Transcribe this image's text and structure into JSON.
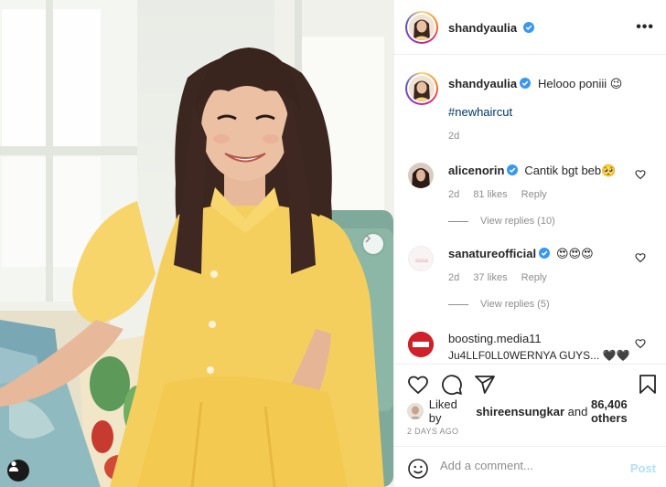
{
  "author": {
    "username": "shandyaulia",
    "verified": true
  },
  "header": {
    "more_label": "•••"
  },
  "caption": {
    "username": "shandyaulia",
    "text": "Helooo poniii 😉",
    "hashtag": "#newhaircut",
    "age": "2d"
  },
  "comments": [
    {
      "username": "alicenorin",
      "verified": true,
      "text": "Cantik bgt beb🥺",
      "age": "2d",
      "likes": "81 likes",
      "reply_label": "Reply",
      "view_replies": "View replies (10)"
    },
    {
      "username": "sanatureofficial",
      "verified": true,
      "text": "😍😍😍",
      "age": "2d",
      "likes": "37 likes",
      "reply_label": "Reply",
      "view_replies": "View replies (5)"
    },
    {
      "username": "boosting.media11",
      "verified": false,
      "text": "Ju4LLF0LL0WERNYA GUYS... 🖤🖤"
    }
  ],
  "likes": {
    "prefix": "Liked by",
    "user": "shireensungkar",
    "and": "and",
    "others": "86,406 others"
  },
  "posted_ago": "2 DAYS AGO",
  "add_comment": {
    "placeholder": "Add a comment...",
    "post_label": "Post"
  },
  "colors": {
    "link": "#00376b",
    "muted": "#8e8e8e",
    "verified": "#3897f0",
    "post_disabled": "#b2dffc",
    "dress": "#f5cf5e"
  },
  "icons": {
    "next": "chevron-right-icon",
    "tag": "user-tag-icon",
    "like": "heart-icon",
    "comment": "comment-bubble-icon",
    "share": "paper-plane-icon",
    "save": "bookmark-icon",
    "emoji": "smiley-icon"
  }
}
